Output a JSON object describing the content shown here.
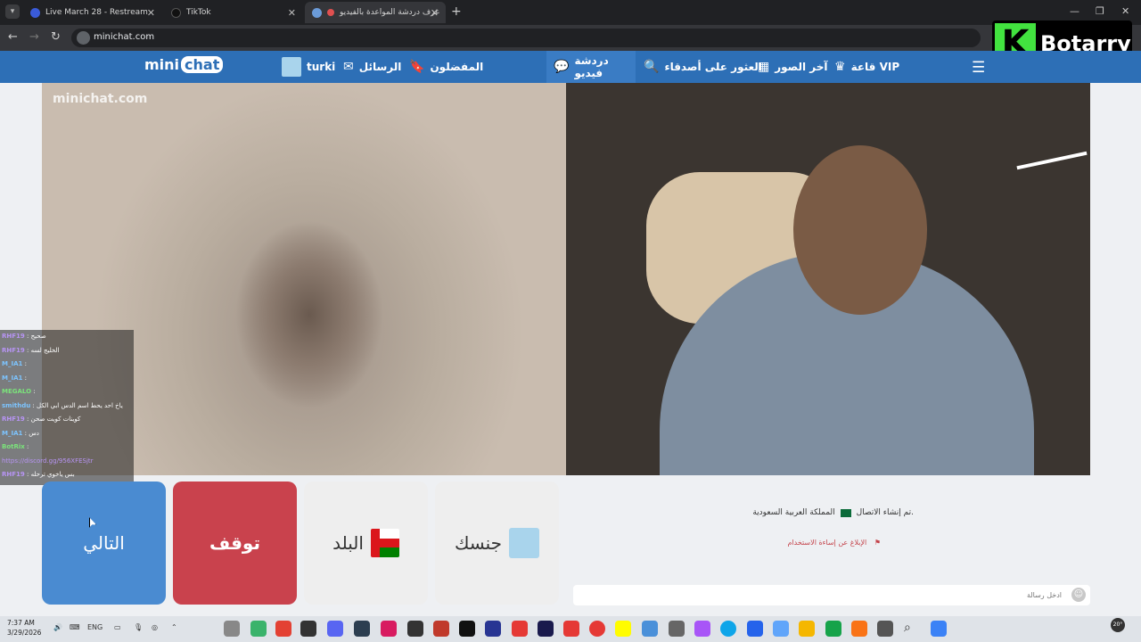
{
  "browser": {
    "tabs": [
      {
        "label": "Live March 28 - Restream",
        "active": false
      },
      {
        "label": "TikTok",
        "active": false
      },
      {
        "label": "غرف دردشة المواعدة بالفيديو",
        "active": true
      }
    ],
    "url": "minichat.com"
  },
  "overlay": {
    "brand": "Botarry",
    "logo_letter": "K"
  },
  "site": {
    "logo_prefix": "mini",
    "logo_chat": "chat",
    "nav": {
      "user": "turki",
      "messages": "الرسائل",
      "favorites": "المفضلون",
      "video_chat": "دردشة فيديو",
      "find_friends": "العثور على أصدقاء",
      "latest_photos": "آخر الصور",
      "vip_room": "قاعة VIP"
    },
    "watermark": "minichat.com"
  },
  "chat_overlay": [
    {
      "user": "RHF19",
      "text": ": صحيح",
      "style": "purple"
    },
    {
      "user": "RHF19",
      "text": ": الخليج لسه",
      "style": "purple"
    },
    {
      "user": "M_IA1",
      "text": ":",
      "style": "blue"
    },
    {
      "user": "M_IA1",
      "text": ":",
      "style": "blue"
    },
    {
      "user": "MEGALO",
      "text": ":",
      "style": "green"
    },
    {
      "user": "smithdu",
      "text": ": ياخ احد يحط اسم الدس ابي الكل",
      "style": "blue"
    },
    {
      "user": "RHF19",
      "text": ": كوينات كويت صحن",
      "style": "purple"
    },
    {
      "user": "M_IA1",
      "text": ": دس",
      "style": "blue"
    },
    {
      "user": "BotRix",
      "text": ":",
      "style": "green"
    },
    {
      "user": "",
      "text": "https://discord.gg/956XFESjtr",
      "style": "link"
    },
    {
      "user": "RHF19",
      "text": ": بس ياخوي ترحله",
      "style": "purple"
    }
  ],
  "buttons": {
    "next": "التالي",
    "stop": "توقف",
    "country": "البلد",
    "gender": "جنسك"
  },
  "chat_panel": {
    "status": "تم إنشاء الاتصال.",
    "country": "المملكة العربية السعودية",
    "report": "الإبلاغ عن إساءة الاستخدام",
    "message_placeholder": "ادخل رسالة"
  },
  "taskbar": {
    "time": "7:37 AM",
    "date": "3/29/2026",
    "lang": "ENG",
    "temp": "20°"
  },
  "colors": {
    "nav_blue": "#2d6fb6",
    "next_blue": "#4a8bd1",
    "stop_red": "#c9424d",
    "botarry_green": "#42e23f"
  }
}
